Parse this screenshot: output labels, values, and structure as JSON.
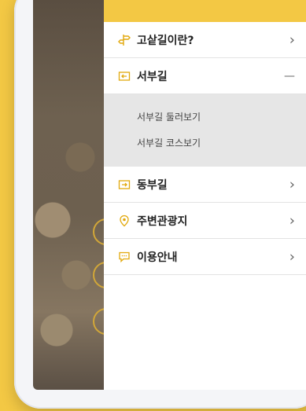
{
  "menu": {
    "items": [
      {
        "label": "고샅길이란?",
        "icon": "signpost-icon",
        "state": "collapsed"
      },
      {
        "label": "서부길",
        "icon": "west-arrow-box-icon",
        "state": "expanded",
        "sub": [
          {
            "label": "서부길 둘러보기"
          },
          {
            "label": "서부길 코스보기"
          }
        ]
      },
      {
        "label": "동부길",
        "icon": "east-arrow-box-icon",
        "state": "collapsed"
      },
      {
        "label": "주변관광지",
        "icon": "location-pin-icon",
        "state": "collapsed"
      },
      {
        "label": "이용안내",
        "icon": "chat-bubble-icon",
        "state": "collapsed"
      }
    ],
    "arrow_right": "›",
    "minus": "—"
  },
  "colors": {
    "accent": "#f3c844",
    "icon": "#e2a90d"
  }
}
